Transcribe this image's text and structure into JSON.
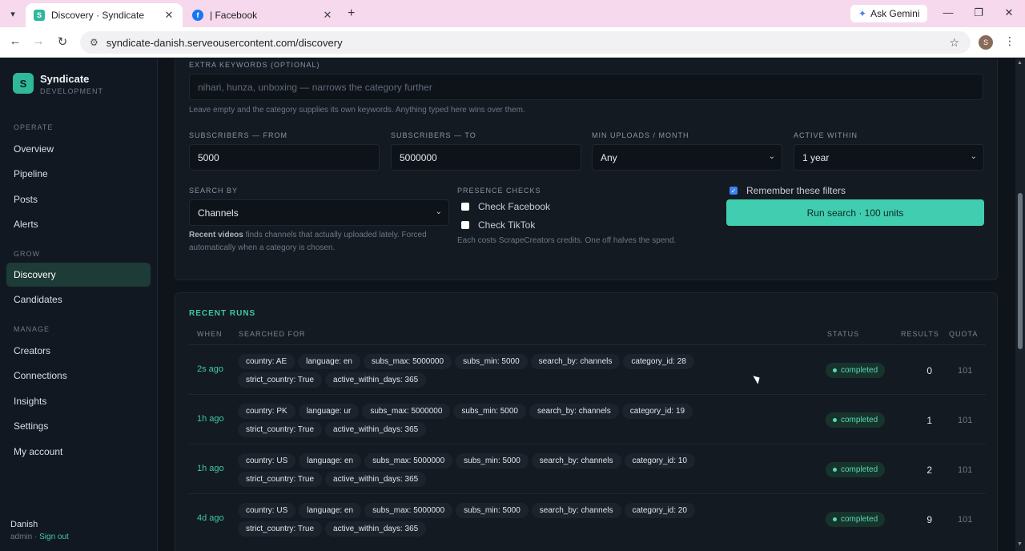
{
  "browser": {
    "tabs": [
      {
        "title": "Discovery · Syndicate",
        "favicon": "S"
      },
      {
        "title": "| Facebook",
        "favicon": "f"
      }
    ],
    "gemini_label": "Ask Gemini",
    "url": "syndicate-danish.serveousercontent.com/discovery",
    "profile_initial": "S"
  },
  "sidebar": {
    "brand_initial": "S",
    "brand_name": "Syndicate",
    "brand_env": "DEVELOPMENT",
    "sections": [
      {
        "label": "OPERATE",
        "items": [
          "Overview",
          "Pipeline",
          "Posts",
          "Alerts"
        ]
      },
      {
        "label": "GROW",
        "items": [
          "Discovery",
          "Candidates"
        ]
      },
      {
        "label": "MANAGE",
        "items": [
          "Creators",
          "Connections",
          "Insights",
          "Settings",
          "My account"
        ]
      }
    ],
    "active_item": "Discovery",
    "user": {
      "name": "Danish",
      "role": "admin · ",
      "signout": "Sign out"
    }
  },
  "filters": {
    "keywords_label": "EXTRA KEYWORDS (OPTIONAL)",
    "keywords_placeholder": "nihari, hunza, unboxing — narrows the category further",
    "keywords_hint": "Leave empty and the category supplies its own keywords. Anything typed here wins over them.",
    "subs_from_label": "SUBSCRIBERS — FROM",
    "subs_from_value": "5000",
    "subs_to_label": "SUBSCRIBERS — TO",
    "subs_to_value": "5000000",
    "min_uploads_label": "MIN UPLOADS / MONTH",
    "min_uploads_value": "Any",
    "active_within_label": "ACTIVE WITHIN",
    "active_within_value": "1 year",
    "search_by_label": "SEARCH BY",
    "search_by_value": "Channels",
    "search_by_hint_bold": "Recent videos",
    "search_by_hint": " finds channels that actually uploaded lately. Forced automatically when a category is chosen.",
    "presence_label": "PRESENCE CHECKS",
    "check_facebook": "Check Facebook",
    "check_tiktok": "Check TikTok",
    "presence_hint": "Each costs ScrapeCreators credits. One off halves the spend.",
    "remember_label": "Remember these filters",
    "run_button": "Run search · 100 units"
  },
  "runs": {
    "title": "RECENT RUNS",
    "columns": {
      "when": "WHEN",
      "searched_for": "SEARCHED FOR",
      "status": "STATUS",
      "results": "RESULTS",
      "quota": "QUOTA"
    },
    "rows": [
      {
        "when": "2s ago",
        "chips": [
          "country: AE",
          "language: en",
          "subs_max: 5000000",
          "subs_min: 5000",
          "search_by: channels",
          "category_id: 28",
          "strict_country: True",
          "active_within_days: 365"
        ],
        "status": "completed",
        "results": "0",
        "quota": "101"
      },
      {
        "when": "1h ago",
        "chips": [
          "country: PK",
          "language: ur",
          "subs_max: 5000000",
          "subs_min: 5000",
          "search_by: channels",
          "category_id: 19",
          "strict_country: True",
          "active_within_days: 365"
        ],
        "status": "completed",
        "results": "1",
        "quota": "101"
      },
      {
        "when": "1h ago",
        "chips": [
          "country: US",
          "language: en",
          "subs_max: 5000000",
          "subs_min: 5000",
          "search_by: channels",
          "category_id: 10",
          "strict_country: True",
          "active_within_days: 365"
        ],
        "status": "completed",
        "results": "2",
        "quota": "101"
      },
      {
        "when": "4d ago",
        "chips": [
          "country: US",
          "language: en",
          "subs_max: 5000000",
          "subs_min: 5000",
          "search_by: channels",
          "category_id: 20",
          "strict_country: True",
          "active_within_days: 365"
        ],
        "status": "completed",
        "results": "9",
        "quota": "101"
      }
    ]
  }
}
